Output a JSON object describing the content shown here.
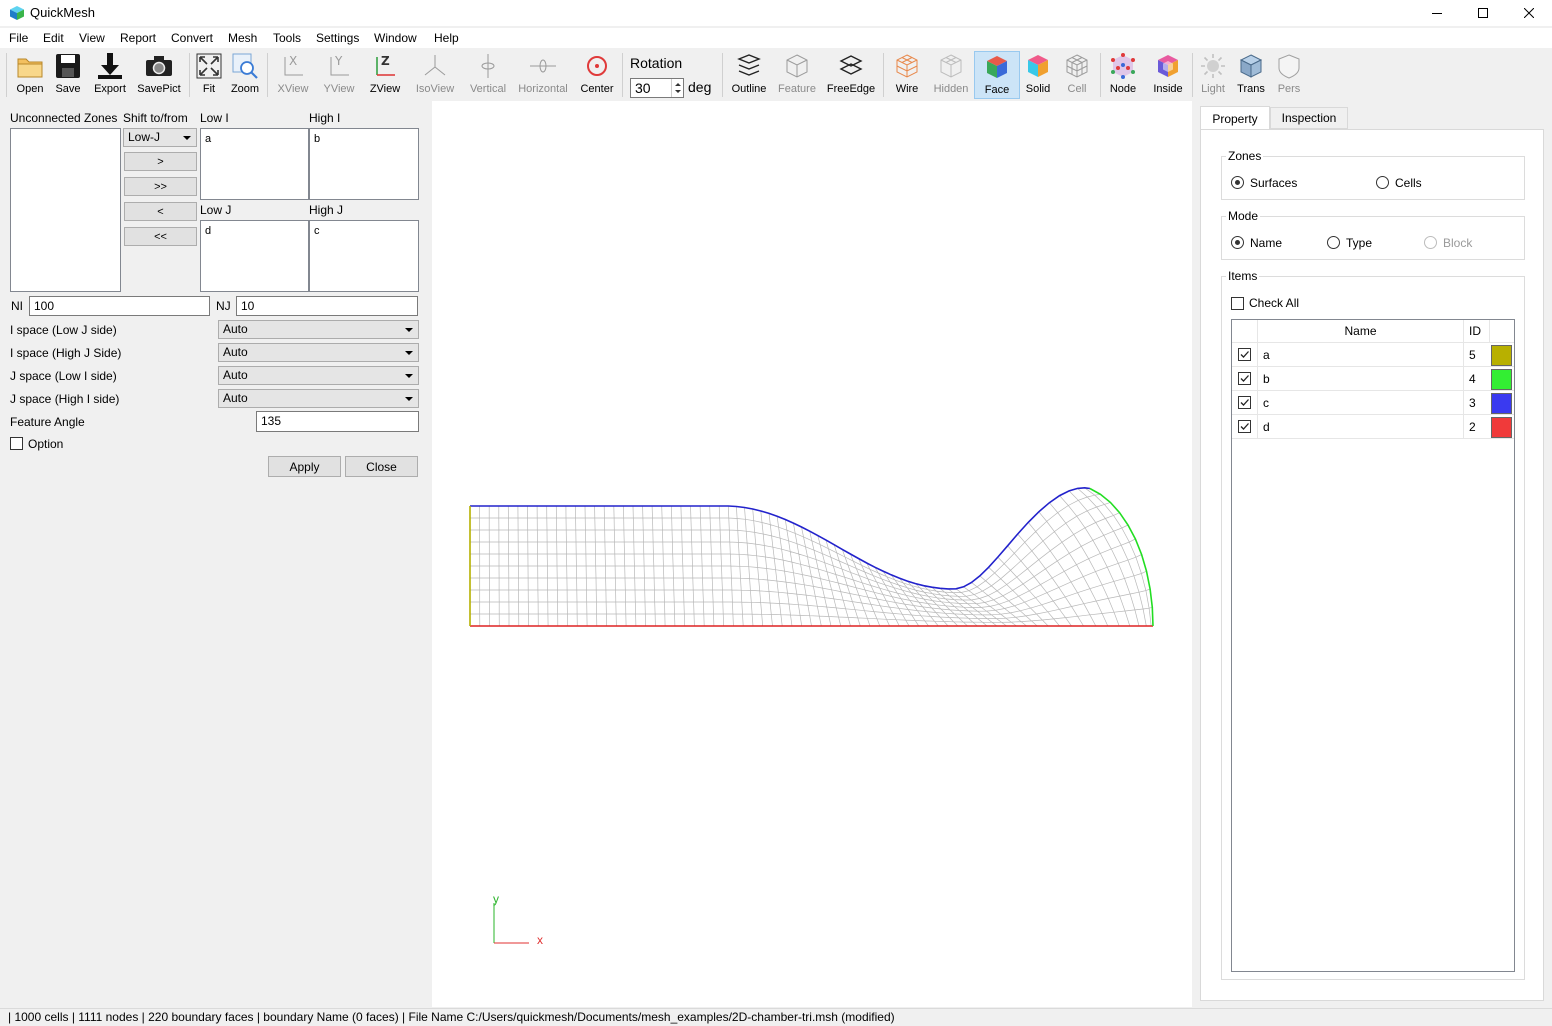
{
  "window": {
    "title": "QuickMesh",
    "minimize_icon": "minimize-icon",
    "maximize_icon": "maximize-icon",
    "close_icon": "close-icon"
  },
  "menu": [
    "File",
    "Edit",
    "View",
    "Report",
    "Convert",
    "Mesh",
    "Tools",
    "Settings",
    "Window",
    "Help"
  ],
  "toolbar": {
    "open": "Open",
    "save": "Save",
    "export": "Export",
    "savepict": "SavePict",
    "fit": "Fit",
    "zoom": "Zoom",
    "xview": "XView",
    "yview": "YView",
    "zview": "ZView",
    "isoview": "IsoView",
    "vertical": "Vertical",
    "horizontal": "Horizontal",
    "center": "Center",
    "rotation_label": "Rotation",
    "rotation_value": "30",
    "rotation_unit": "deg",
    "outline": "Outline",
    "feature": "Feature",
    "freeedge": "FreeEdge",
    "wire": "Wire",
    "hidden": "Hidden",
    "face": "Face",
    "solid": "Solid",
    "cell": "Cell",
    "node": "Node",
    "inside": "Inside",
    "light": "Light",
    "trans": "Trans",
    "pers": "Pers"
  },
  "left": {
    "unconnected_zones": "Unconnected Zones",
    "shift_label": "Shift to/from",
    "shift_selected": "Low-J",
    "btn_shift_one": ">",
    "btn_shift_all": ">>",
    "btn_back_one": "<",
    "btn_back_all": "<<",
    "low_i_label": "Low I",
    "low_i_value": "a",
    "high_i_label": "High I",
    "high_i_value": "b",
    "low_j_label": "Low J",
    "low_j_value": "d",
    "high_j_label": "High J",
    "high_j_value": "c",
    "ni_label": "NI",
    "ni_value": "100",
    "nj_label": "NJ",
    "nj_value": "10",
    "i_space_low_label": "I space (Low J side)",
    "i_space_low_value": "Auto",
    "i_space_high_label": "I space (High J Side)",
    "i_space_high_value": "Auto",
    "j_space_low_label": "J space (Low I side)",
    "j_space_low_value": "Auto",
    "j_space_high_label": "J space (High I side)",
    "j_space_high_value": "Auto",
    "feature_angle_label": "Feature Angle",
    "feature_angle_value": "135",
    "option_label": "Option",
    "apply": "Apply",
    "close": "Close"
  },
  "viewport": {
    "axis_y": "y",
    "axis_x": "x",
    "colors": {
      "edge_a": "#b5b000",
      "edge_b": "#22dd22",
      "edge_c": "#2222cc",
      "edge_d": "#dd2222",
      "grid": "#b8b8b8"
    }
  },
  "right": {
    "tab_property": "Property",
    "tab_inspection": "Inspection",
    "zones_title": "Zones",
    "zones_surfaces": "Surfaces",
    "zones_cells": "Cells",
    "mode_title": "Mode",
    "mode_name": "Name",
    "mode_type": "Type",
    "mode_block": "Block",
    "items_title": "Items",
    "check_all": "Check All",
    "col_name": "Name",
    "col_id": "ID",
    "rows": [
      {
        "name": "a",
        "id": "5",
        "color": "#b8b000",
        "checked": true
      },
      {
        "name": "b",
        "id": "4",
        "color": "#33ee33",
        "checked": true
      },
      {
        "name": "c",
        "id": "3",
        "color": "#3a3af0",
        "checked": true
      },
      {
        "name": "d",
        "id": "2",
        "color": "#f03a3a",
        "checked": true
      }
    ]
  },
  "status": {
    "text": "| 1000 cells | 1111 nodes | 220 boundary faces |  boundary Name  (0 faces) | File Name C:/Users/quickmesh/Documents/mesh_examples/2D-chamber-tri.msh (modified)"
  }
}
